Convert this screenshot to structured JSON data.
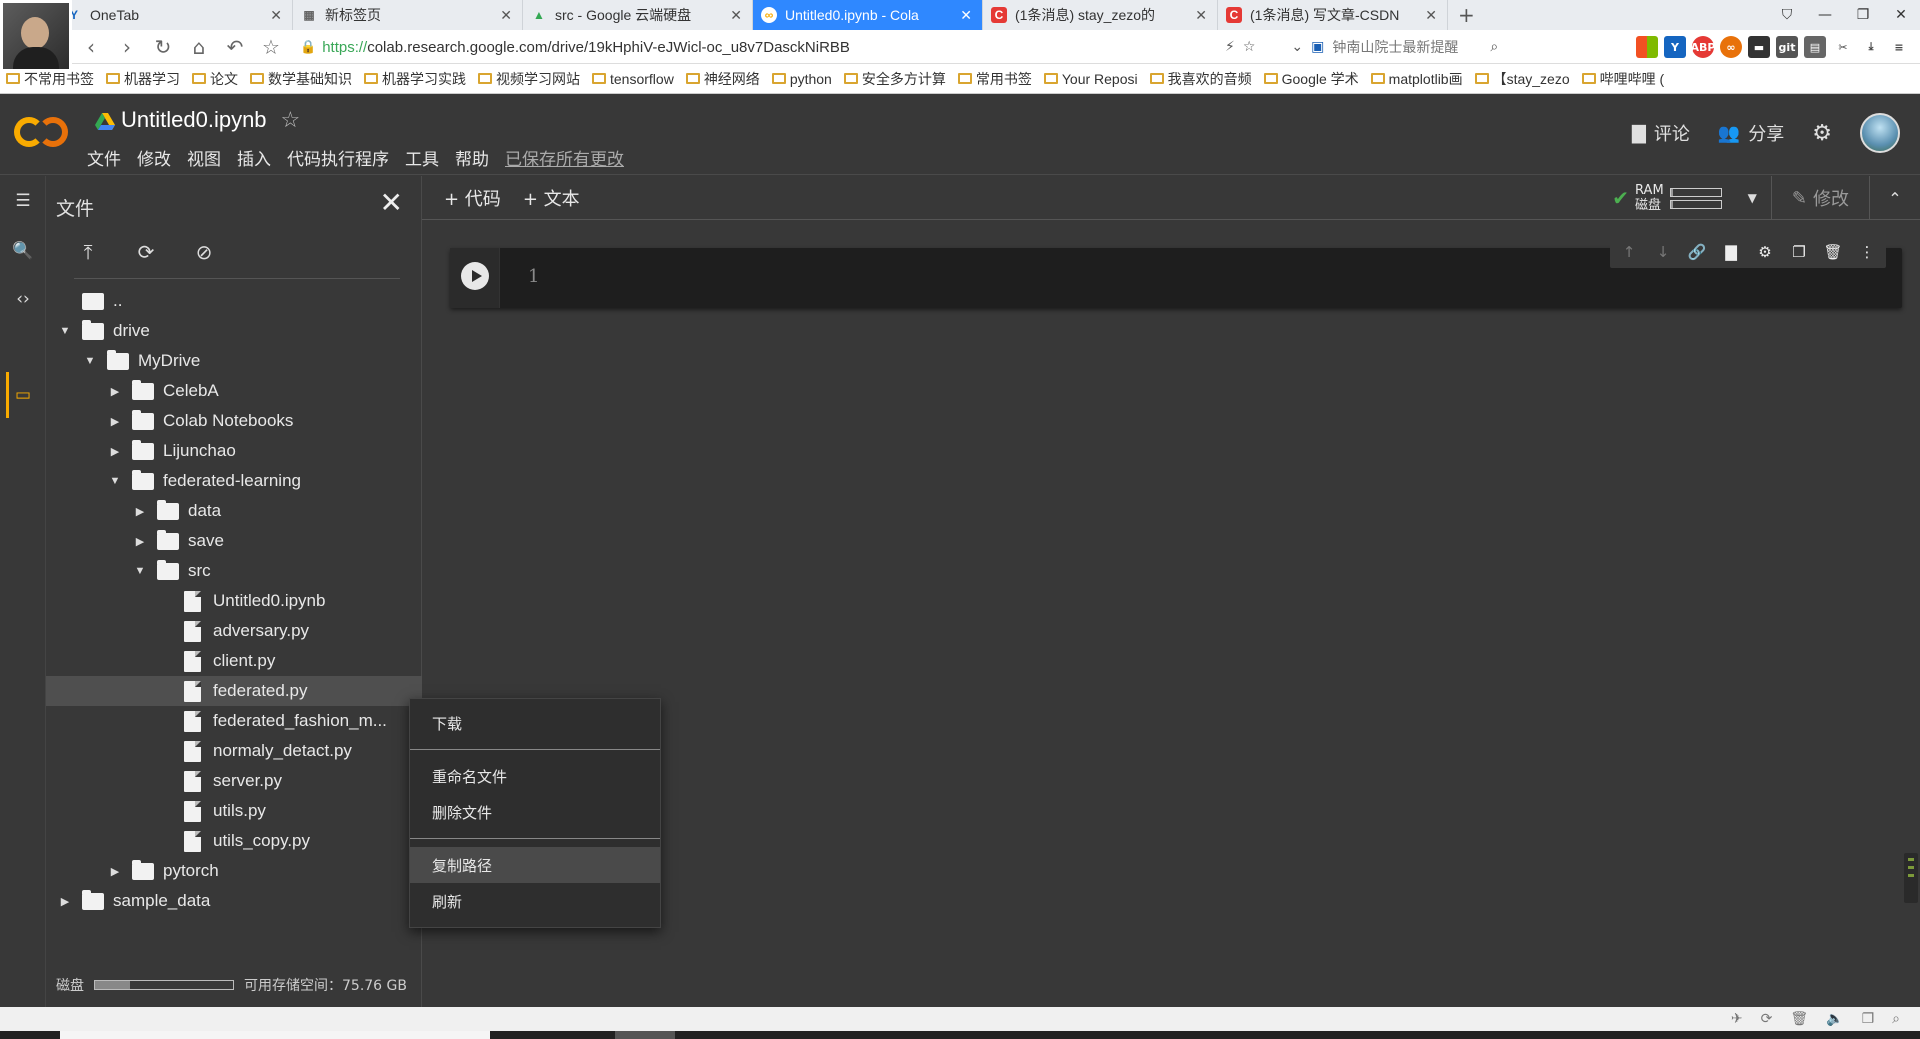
{
  "browser": {
    "tabs": [
      {
        "title": "OneTab",
        "icon": "onetab-icon",
        "active": false
      },
      {
        "title": "新标签页",
        "icon": "grid-icon",
        "active": false
      },
      {
        "title": "src - Google 云端硬盘",
        "icon": "google-drive-icon",
        "active": false
      },
      {
        "title": "Untitled0.ipynb - Cola",
        "icon": "colab-icon",
        "active": true
      },
      {
        "title": "(1条消息) stay_zezo的",
        "icon": "csdn-icon",
        "active": false
      },
      {
        "title": "(1条消息) 写文章-CSDN",
        "icon": "csdn-icon",
        "active": false
      }
    ],
    "new_tab": "+",
    "window_controls": [
      "⛉",
      "—",
      "❐",
      "✕"
    ],
    "url_scheme": "https://",
    "url_rest": "colab.research.google.com/drive/19kHphiV-eJWicl-oc_u8v7DasckNiRBB",
    "search_hint": "钟南山院士最新提醒",
    "bookmarks": [
      "不常用书签",
      "机器学习",
      "论文",
      "数学基础知识",
      "机器学习实践",
      "视频学习网站",
      "tensorflow",
      "神经网络",
      "python",
      "安全多方计算",
      "常用书签",
      "Your Reposi",
      "我喜欢的音频",
      "Google 学术",
      "matplotlib画",
      "【stay_zezo",
      "哔哩哔哩 ("
    ]
  },
  "colab": {
    "notebook_name": "Untitled0.ipynb",
    "menus": [
      "文件",
      "修改",
      "视图",
      "插入",
      "代码执行程序",
      "工具",
      "帮助"
    ],
    "saved_status": "已保存所有更改",
    "comment_label": "评论",
    "share_label": "分享",
    "add_code": "+ 代码",
    "add_text": "+ 文本",
    "ram_label": "RAM",
    "disk_label": "磁盘",
    "ram_usage": 0.05,
    "disk_usage": 0.05,
    "edit_label": "修改",
    "line_number": "1"
  },
  "files_panel": {
    "title": "文件",
    "tree": [
      {
        "name": "..",
        "type": "up",
        "depth": 0,
        "caret": ""
      },
      {
        "name": "drive",
        "type": "folder",
        "depth": 0,
        "caret": "▼"
      },
      {
        "name": "MyDrive",
        "type": "folder",
        "depth": 1,
        "caret": "▼"
      },
      {
        "name": "CelebA",
        "type": "folder",
        "depth": 2,
        "caret": "▶"
      },
      {
        "name": "Colab Notebooks",
        "type": "folder",
        "depth": 2,
        "caret": "▶"
      },
      {
        "name": "Lijunchao",
        "type": "folder",
        "depth": 2,
        "caret": "▶"
      },
      {
        "name": "federated-learning",
        "type": "folder",
        "depth": 2,
        "caret": "▼"
      },
      {
        "name": "data",
        "type": "folder",
        "depth": 3,
        "caret": "▶"
      },
      {
        "name": "save",
        "type": "folder",
        "depth": 3,
        "caret": "▶"
      },
      {
        "name": "src",
        "type": "folder",
        "depth": 3,
        "caret": "▼"
      },
      {
        "name": "Untitled0.ipynb",
        "type": "file",
        "depth": 4,
        "caret": ""
      },
      {
        "name": "adversary.py",
        "type": "file",
        "depth": 4,
        "caret": ""
      },
      {
        "name": "client.py",
        "type": "file",
        "depth": 4,
        "caret": ""
      },
      {
        "name": "federated.py",
        "type": "file",
        "depth": 4,
        "caret": "",
        "selected": true
      },
      {
        "name": "federated_fashion_m...",
        "type": "file",
        "depth": 4,
        "caret": ""
      },
      {
        "name": "normaly_detact.py",
        "type": "file",
        "depth": 4,
        "caret": ""
      },
      {
        "name": "server.py",
        "type": "file",
        "depth": 4,
        "caret": ""
      },
      {
        "name": "utils.py",
        "type": "file",
        "depth": 4,
        "caret": ""
      },
      {
        "name": "utils_copy.py",
        "type": "file",
        "depth": 4,
        "caret": ""
      },
      {
        "name": "pytorch",
        "type": "folder",
        "depth": 2,
        "caret": "▶"
      },
      {
        "name": "sample_data",
        "type": "folder",
        "depth": 0,
        "caret": "▶"
      }
    ],
    "disk_label": "磁盘",
    "disk_usage": 0.25,
    "storage_text": "可用存储空间：75.76 GB"
  },
  "context_menu": {
    "download": "下载",
    "rename": "重命名文件",
    "delete": "删除文件",
    "copy_path": "复制路径",
    "refresh": "刷新"
  },
  "colors": {
    "accent": "#f9ab00",
    "tab_active": "#2f88ff",
    "bg": "#383838"
  }
}
